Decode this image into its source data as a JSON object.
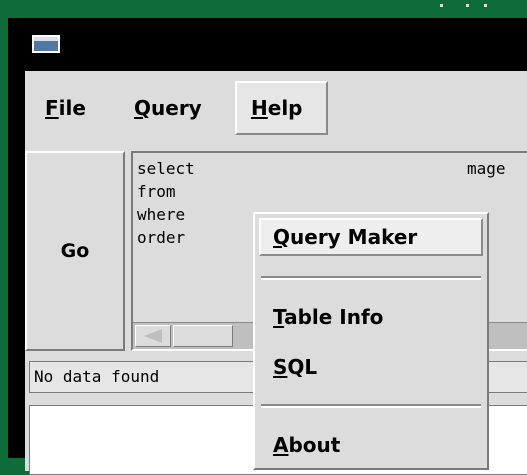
{
  "menubar": {
    "file": "File",
    "query": "Query",
    "help": "Help"
  },
  "help_menu": {
    "items": [
      "Query Maker",
      "Table Info",
      "SQL",
      "About"
    ]
  },
  "go_button": "Go",
  "editor": {
    "text": "select\nfrom\nwhere\norder",
    "clipped_tail": "mage"
  },
  "status": {
    "text": "No data found"
  },
  "icons": {
    "window_icon": "window-icon",
    "scroll_left": "scroll-left-arrow-icon"
  },
  "colors": {
    "desktop": "#0e6b3a",
    "title_bar": "#000000",
    "panel": "#dcdcdc",
    "results_bg": "#ffffff"
  }
}
